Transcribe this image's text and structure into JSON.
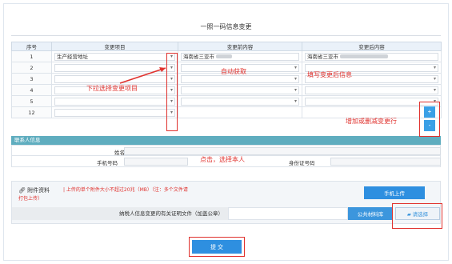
{
  "page": {
    "title": "一照一码信息变更"
  },
  "table": {
    "headers": [
      "序号",
      "变更项目",
      "变更前内容",
      "变更后内容"
    ],
    "rows": [
      {
        "index": "1",
        "item": "生产经营地址",
        "before": "海南省三亚市",
        "after": "海南省三亚市"
      },
      {
        "index": "2",
        "item": "",
        "before": "",
        "after": ""
      },
      {
        "index": "3",
        "item": "",
        "before": "",
        "after": ""
      },
      {
        "index": "4",
        "item": "",
        "before": "",
        "after": ""
      },
      {
        "index": "5",
        "item": "",
        "before": "",
        "after": ""
      },
      {
        "index": "12",
        "item": "",
        "before": "",
        "after": ""
      }
    ],
    "add_row_label": "+",
    "del_row_label": "-"
  },
  "contact": {
    "section_title": "联系人信息",
    "name_label": "姓名",
    "phone_label": "手机号码",
    "id_label": "身份证号码"
  },
  "attachment": {
    "title": "附件资料",
    "note_line1": "| 上传的单个附件大小不超过20兆（MB）（注：多个文件请",
    "note_line2": "打包上传）",
    "upload_button": "手机上传",
    "doc_label": "纳税人信息变更的有关证明文件（加盖公章）",
    "public_lib_button": "公共材料库",
    "choose_button": "请选择"
  },
  "submit_label": "提 交",
  "annotations": {
    "dropdown_hint": "下拉选择变更项目",
    "auto_fetch": "自动获取",
    "fill_after": "填写变更后信息",
    "add_delete": "增加或删减变更行",
    "click_select": "点击，选择本人"
  },
  "colors": {
    "accent": "#2e8fe0",
    "annotation": "#e0322e",
    "section_bar": "#5fadbf"
  }
}
